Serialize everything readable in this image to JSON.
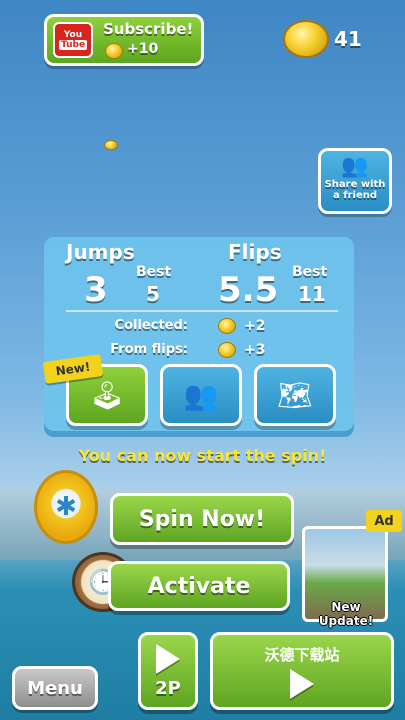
{
  "subscribe": {
    "label": "Subscribe!",
    "reward": "+10",
    "logo_top": "You",
    "logo_bottom": "Tube"
  },
  "coins": {
    "count": "41"
  },
  "share": {
    "label": "Share with a friend",
    "icon": "group-icon"
  },
  "stats": {
    "jumps_label": "Jumps",
    "jumps_value": "3",
    "jumps_best_label": "Best",
    "jumps_best_value": "5",
    "flips_label": "Flips",
    "flips_value": "5.5",
    "flips_best_label": "Best",
    "flips_best_value": "11",
    "collected_label": "Collected:",
    "collected_value": "+2",
    "from_flips_label": "From flips:",
    "from_flips_value": "+3"
  },
  "panel_buttons": {
    "new_badge": "New!",
    "controller_icon": "joystick-icon",
    "group_icon": "group-icon",
    "map_icon": "map-icon"
  },
  "message": "You can now start the spin!",
  "spin_button": "Spin Now!",
  "activate_button": "Activate",
  "ad": {
    "tag": "Ad",
    "label": "New Update!"
  },
  "bottom": {
    "menu": "Menu",
    "two_player": "2P",
    "watermark": "沃德下载站"
  },
  "colors": {
    "green": "#6ab82c",
    "blue": "#2a8dc4",
    "yellow_text": "#f7e63a"
  }
}
